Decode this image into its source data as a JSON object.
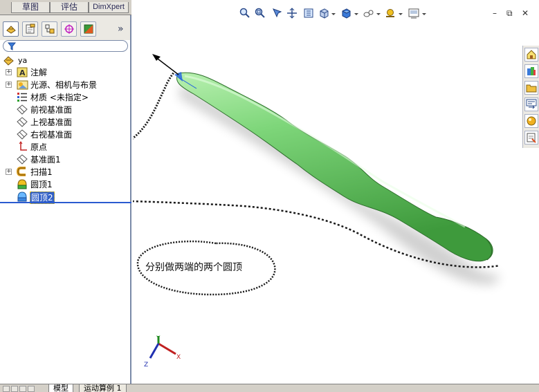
{
  "top_tabs": [
    "草图",
    "评估",
    "DimXpert"
  ],
  "panel_tabs": [
    {
      "icon": "feature-manager-icon"
    },
    {
      "icon": "property-manager-icon"
    },
    {
      "icon": "configuration-manager-icon"
    },
    {
      "icon": "dimxpert-manager-icon"
    },
    {
      "icon": "display-manager-icon"
    }
  ],
  "panel_more": "»",
  "tree": {
    "root": "ya",
    "items": [
      {
        "label": "注解",
        "icon": "annotations-icon",
        "expandable": true
      },
      {
        "label": "光源、相机与布景",
        "icon": "lights-cameras-icon",
        "expandable": true
      },
      {
        "label": "材质 <未指定>",
        "icon": "material-icon",
        "expandable": false
      },
      {
        "label": "前视基准面",
        "icon": "plane-icon",
        "expandable": false
      },
      {
        "label": "上视基准面",
        "icon": "plane-icon",
        "expandable": false
      },
      {
        "label": "右视基准面",
        "icon": "plane-icon",
        "expandable": false
      },
      {
        "label": "原点",
        "icon": "origin-icon",
        "expandable": false
      },
      {
        "label": "基准面1",
        "icon": "plane-icon",
        "expandable": false
      },
      {
        "label": "扫描1",
        "icon": "sweep-icon",
        "expandable": true
      },
      {
        "label": "圆顶1",
        "icon": "dome-icon",
        "expandable": false
      },
      {
        "label": "圆顶2",
        "icon": "dome-icon",
        "expandable": false,
        "selected": true
      }
    ]
  },
  "bottom_tabs": [
    "模型",
    "运动算例 1"
  ],
  "window_controls": {
    "minimize": "–",
    "restore": "⧉",
    "close": "✕"
  },
  "annotation_text": "分别做两端的两个圆顶",
  "triad": {
    "x": "X",
    "y": "Y",
    "z": "Z"
  },
  "colors": {
    "model_green": "#7ed67a",
    "sketch_ink": "#1a1a1a",
    "selection_blue": "#3160c8"
  }
}
